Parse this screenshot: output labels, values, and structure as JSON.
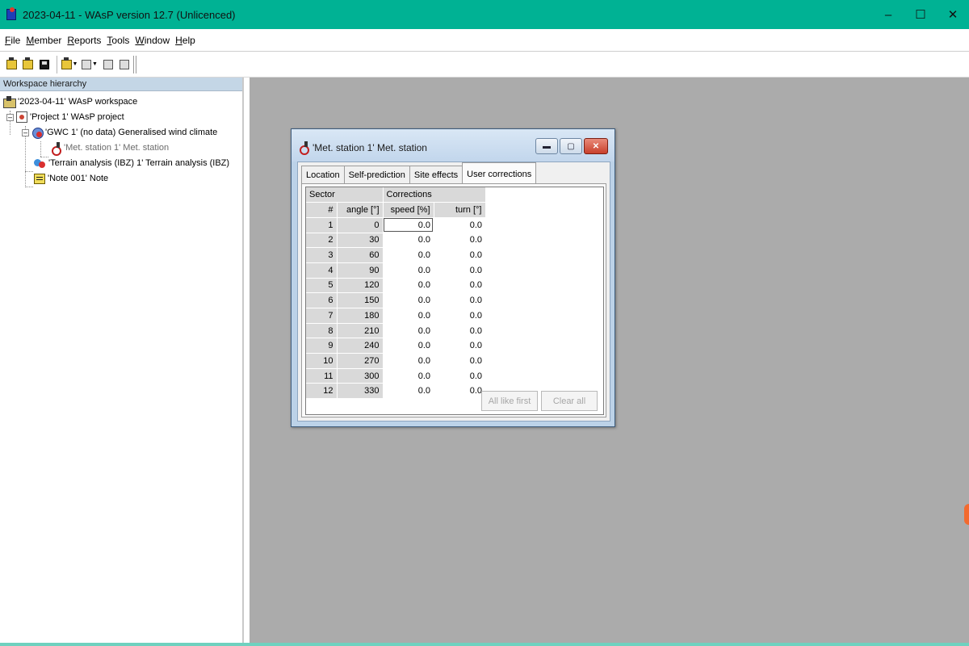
{
  "window": {
    "title": "2023-04-11 - WAsP version 12.7  (Unlicenced)",
    "controls": {
      "minimize": "–",
      "maximize": "☐",
      "close": "✕"
    }
  },
  "menu": [
    {
      "key": "F",
      "rest": "ile"
    },
    {
      "key": "M",
      "rest": "ember"
    },
    {
      "key": "R",
      "rest": "eports"
    },
    {
      "key": "T",
      "rest": "ools"
    },
    {
      "key": "W",
      "rest": "indow"
    },
    {
      "key": "H",
      "rest": "elp"
    }
  ],
  "workspace": {
    "panel_title": "Workspace hierarchy",
    "nodes": {
      "workspace": "'2023-04-11' WAsP workspace",
      "project": "'Project 1' WAsP project",
      "gwc": "'GWC 1' (no data) Generalised wind climate",
      "met_station": "'Met. station 1' Met. station",
      "terrain": "'Terrain analysis (IBZ) 1' Terrain analysis (IBZ)",
      "note": "'Note 001' Note"
    },
    "expand_symbol": "–"
  },
  "dialog": {
    "title": "'Met. station 1' Met. station",
    "buttons": {
      "minimize": "▬",
      "restore": "▢",
      "close": "✕"
    },
    "tabs": [
      "Location",
      "Self-prediction",
      "Site effects",
      "User corrections"
    ],
    "active_tab": "User corrections",
    "table": {
      "group_headers": {
        "sector": "Sector",
        "corrections": "Corrections"
      },
      "columns": {
        "index": "#",
        "angle": "angle [°]",
        "speed": "speed [%]",
        "turn": "turn [°]"
      },
      "rows": [
        {
          "n": "1",
          "angle": "0",
          "speed": "0.0",
          "turn": "0.0"
        },
        {
          "n": "2",
          "angle": "30",
          "speed": "0.0",
          "turn": "0.0"
        },
        {
          "n": "3",
          "angle": "60",
          "speed": "0.0",
          "turn": "0.0"
        },
        {
          "n": "4",
          "angle": "90",
          "speed": "0.0",
          "turn": "0.0"
        },
        {
          "n": "5",
          "angle": "120",
          "speed": "0.0",
          "turn": "0.0"
        },
        {
          "n": "6",
          "angle": "150",
          "speed": "0.0",
          "turn": "0.0"
        },
        {
          "n": "7",
          "angle": "180",
          "speed": "0.0",
          "turn": "0.0"
        },
        {
          "n": "8",
          "angle": "210",
          "speed": "0.0",
          "turn": "0.0"
        },
        {
          "n": "9",
          "angle": "240",
          "speed": "0.0",
          "turn": "0.0"
        },
        {
          "n": "10",
          "angle": "270",
          "speed": "0.0",
          "turn": "0.0"
        },
        {
          "n": "11",
          "angle": "300",
          "speed": "0.0",
          "turn": "0.0"
        },
        {
          "n": "12",
          "angle": "330",
          "speed": "0.0",
          "turn": "0.0"
        }
      ]
    },
    "actions": {
      "all_like_first": "All like first",
      "clear_all": "Clear all"
    }
  },
  "colors": {
    "titlebar": "#00b294",
    "mdi_background": "#ababab",
    "panel_header": "#c4d6e6"
  }
}
